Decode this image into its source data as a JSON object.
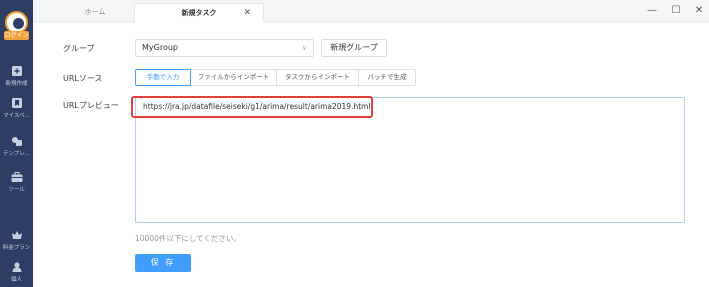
{
  "sidebar": {
    "logo_text": "ログイン",
    "items": [
      {
        "label": "新規作成",
        "icon": "plus-icon"
      },
      {
        "label": "マイスペ...",
        "icon": "bookmark-icon"
      },
      {
        "label": "テンプレ...",
        "icon": "template-icon"
      },
      {
        "label": "ツール",
        "icon": "toolbox-icon"
      },
      {
        "label": "料金プラン",
        "icon": "crown-icon"
      },
      {
        "label": "個人",
        "icon": "user-icon"
      }
    ]
  },
  "tabs": {
    "home": "ホーム",
    "new_task": "新規タスク",
    "close": "✕"
  },
  "window": {
    "minimize": "—",
    "maximize": "☐",
    "close": "✕"
  },
  "form": {
    "group_label": "グループ",
    "group_value": "MyGroup",
    "new_group_button": "新規グループ",
    "url_source_label": "URLソース",
    "url_source_options": [
      "手動で入力",
      "ファイルからインポート",
      "タスクからインポート",
      "バッチで生成"
    ],
    "url_source_selected": "手動で入力",
    "url_preview_label": "URLプレビュー",
    "url_value": "https://jra.jp/datafile/seiseki/g1/arima/result/arima2019.html",
    "hint": "10000件以下にしてください。",
    "save_button": "保 存"
  },
  "colors": {
    "accent": "#409eff",
    "sidebar": "#2c3e63",
    "highlight": "#e0403a"
  }
}
